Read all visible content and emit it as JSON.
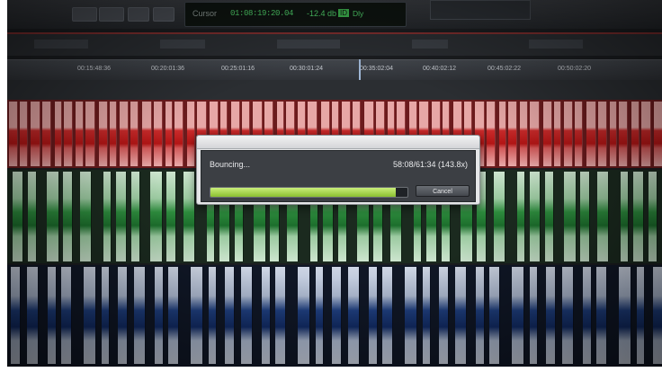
{
  "transport": {
    "counter_label": "Cursor",
    "counter_value": "01:08:19:20.04",
    "level": "-12.4 db",
    "mode_badge": "ID",
    "delay_label": "Dly"
  },
  "ruler": {
    "timecodes": [
      "00:15:48:36",
      "00:20:01:36",
      "00:25:01:16",
      "00:30:01:24",
      "00:35:02:04",
      "00:40:02:12",
      "00:45:02:22",
      "00:50:02:20"
    ]
  },
  "bounce_dialog": {
    "status_label": "Bouncing...",
    "time_readout": "58:08/61:34 (143.8x)",
    "progress_fraction": 0.94,
    "cancel_label": "Cancel"
  },
  "colors": {
    "audio_track_red": "#c82a2a",
    "audio_track_green": "#2d8b3d",
    "audio_track_blue": "#1f3f80",
    "progress_green": "#9acb3a"
  }
}
